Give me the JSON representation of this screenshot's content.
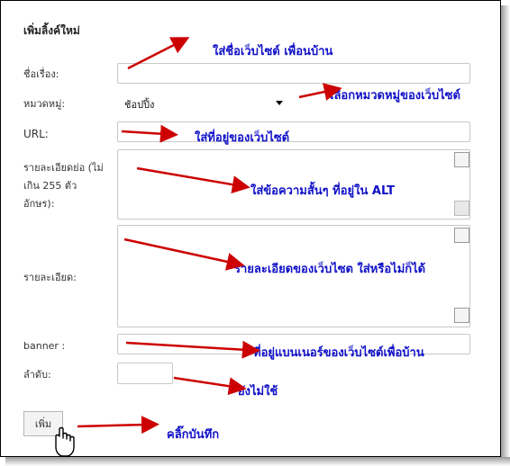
{
  "form": {
    "heading": "เพิ่มลิ้งค์ใหม่",
    "title_label": "ชื่อเรื่อง:",
    "category_label": "หมวดหมู่:",
    "category_value": "ช้อปปิ้ง",
    "url_label": "URL:",
    "short_desc_label_1": "รายละเอียดย่อ (ไม่",
    "short_desc_label_2": "เกิน 255 ตัว",
    "short_desc_label_3": "อักษร):",
    "detail_label": "รายละเอียด:",
    "banner_label": "banner :",
    "order_label": "ลำดับ:",
    "submit_label": "เพิ่ม"
  },
  "annotations": {
    "title": "ใส่ชื่อเว็บไซต์ เพื่อนบ้าน",
    "category": "เลือกหมวดหมู่ของเว็บไซต์",
    "url": "ใส่ที่อยู่ของเว็บไซต์",
    "short_desc": "ใส่ข้อความสั้นๆ ที่อยู่ใน ALT",
    "detail": "รายละเอียดของเว็บไซต ใส่หรือไม่ก็ได้",
    "banner": "ที่อยู่แบนเนอร์ของเว็บไซต์เพื่อบ้าน",
    "order": "ยังไม่ใช้",
    "submit": "คลิ๊กบันทึก"
  },
  "colors": {
    "annotation_text": "#1010c8",
    "arrow": "#cc0000"
  }
}
